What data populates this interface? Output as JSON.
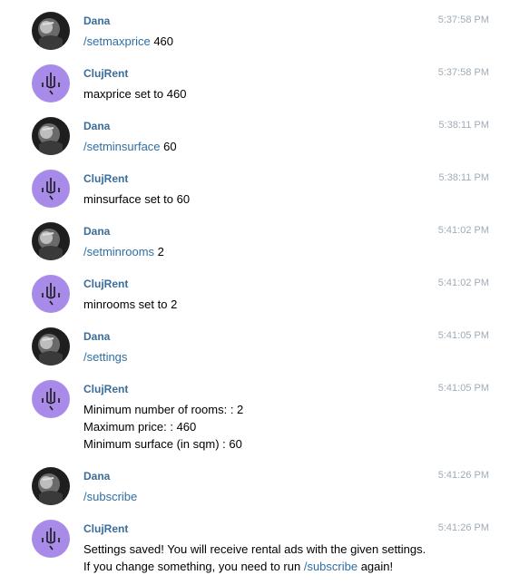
{
  "colors": {
    "sender_name": "#3a6d99",
    "timestamp": "#a0acb6",
    "command_link": "#2f6ea5",
    "bot_avatar_bg": "#a88be8",
    "user_avatar_bg": "#1e1e1e"
  },
  "messages": [
    {
      "sender": "Dana",
      "avatar": "user-avatar",
      "time": "5:37:58 PM",
      "command": "/setmaxprice",
      "arg": " 460"
    },
    {
      "sender": "ClujRent",
      "avatar": "bot-avatar",
      "time": "5:37:58 PM",
      "lines": [
        "maxprice set to 460"
      ]
    },
    {
      "sender": "Dana",
      "avatar": "user-avatar",
      "time": "5:38:11 PM",
      "command": "/setminsurface",
      "arg": " 60"
    },
    {
      "sender": "ClujRent",
      "avatar": "bot-avatar",
      "time": "5:38:11 PM",
      "lines": [
        "minsurface set to 60"
      ]
    },
    {
      "sender": "Dana",
      "avatar": "user-avatar",
      "time": "5:41:02 PM",
      "command": "/setminrooms",
      "arg": " 2"
    },
    {
      "sender": "ClujRent",
      "avatar": "bot-avatar",
      "time": "5:41:02 PM",
      "lines": [
        "minrooms set to 2"
      ]
    },
    {
      "sender": "Dana",
      "avatar": "user-avatar",
      "time": "5:41:05 PM",
      "command": "/settings",
      "arg": ""
    },
    {
      "sender": "ClujRent",
      "avatar": "bot-avatar",
      "time": "5:41:05 PM",
      "lines": [
        "Minimum number of rooms: : 2",
        "Maximum price: : 460",
        "Minimum surface (in sqm) : 60"
      ]
    },
    {
      "sender": "Dana",
      "avatar": "user-avatar",
      "time": "5:41:26 PM",
      "command": "/subscribe",
      "arg": ""
    },
    {
      "sender": "ClujRent",
      "avatar": "bot-avatar",
      "time": "5:41:26 PM",
      "lines": [
        "Settings saved! You will receive rental ads with the given settings."
      ],
      "last_line": {
        "before": "If you change something, you need to run ",
        "link": "/subscribe",
        "after": " again!"
      }
    }
  ]
}
